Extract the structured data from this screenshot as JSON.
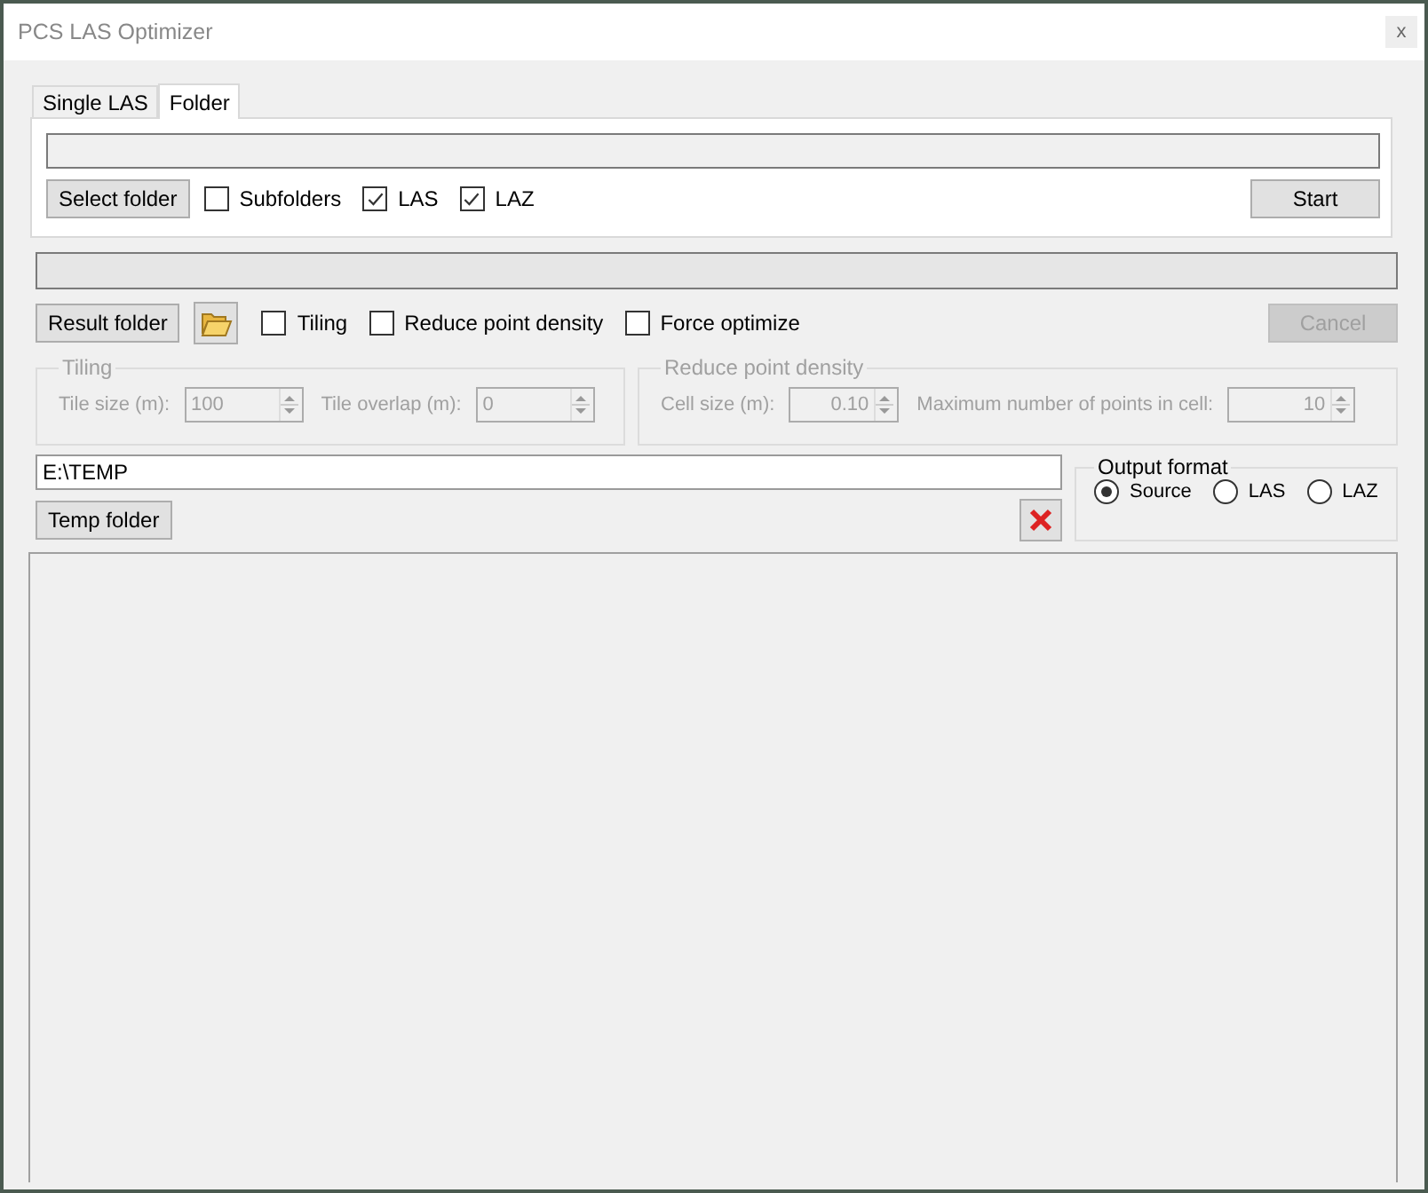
{
  "window": {
    "title": "PCS LAS Optimizer",
    "close": "x"
  },
  "tabs": [
    {
      "label": "Single LAS",
      "selected": false
    },
    {
      "label": "Folder",
      "selected": true
    }
  ],
  "folder_panel": {
    "select_button": "Select folder",
    "options": [
      {
        "label": "Subfolders",
        "checked": false
      },
      {
        "label": "LAS",
        "checked": true
      },
      {
        "label": "LAZ",
        "checked": true
      }
    ],
    "start_button": "Start"
  },
  "progress": {
    "level": 0
  },
  "result_row": {
    "result_button": "Result folder",
    "options": [
      {
        "label": "Tiling",
        "checked": false
      },
      {
        "label": "Reduce point density",
        "checked": false
      },
      {
        "label": "Force optimize",
        "checked": false
      }
    ],
    "cancel_button": {
      "label": "Cancel",
      "disabled": true
    }
  },
  "groups": [
    {
      "title": "Tiling",
      "disabled": true,
      "fields": [
        {
          "label": "Tile size (m):",
          "value": "100"
        },
        {
          "label": "Tile overlap (m):",
          "value": "0"
        }
      ]
    },
    {
      "title": "Reduce point density",
      "disabled": true,
      "fields": [
        {
          "label": "Cell size (m):",
          "value": "0.10"
        },
        {
          "label": "Maximum number of points in cell:",
          "value": "10"
        }
      ]
    }
  ],
  "temp": {
    "path": "E:\\TEMP",
    "button": "Temp folder"
  },
  "output_format": {
    "title": "Output format",
    "options": [
      {
        "label": "Source",
        "selected": true
      },
      {
        "label": "LAS",
        "selected": false
      },
      {
        "label": "LAZ",
        "selected": false
      }
    ]
  }
}
